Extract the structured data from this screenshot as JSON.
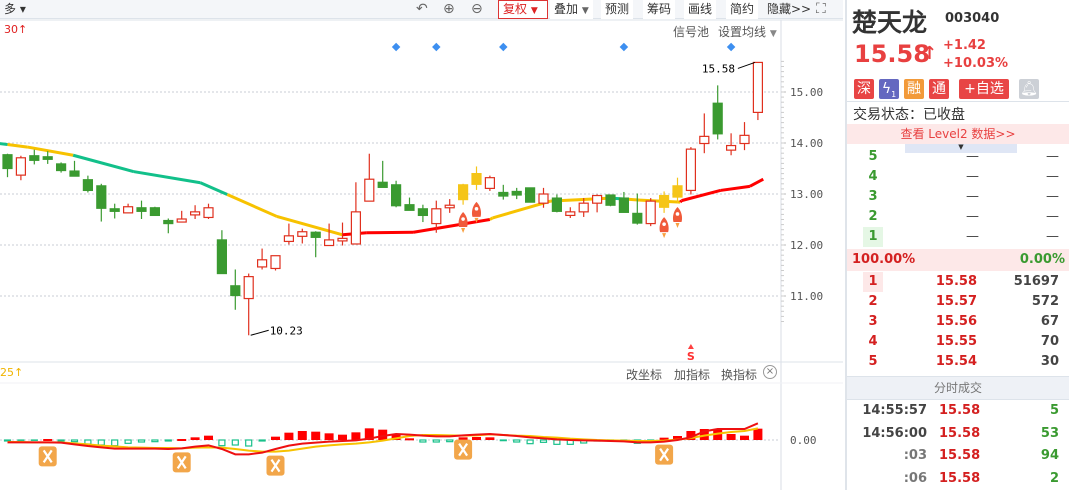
{
  "toolbar": {
    "more_label": "多",
    "rights_label": "复权",
    "overlay_label": "叠加",
    "forecast_label": "预测",
    "chips_label": "筹码",
    "draw_label": "画线",
    "simple_label": "简约",
    "hide_label": "隐藏>>",
    "icons": [
      "undo-icon",
      "zoom-in-icon",
      "zoom-out-icon",
      "fullscreen-icon"
    ]
  },
  "main_chart": {
    "period_label": "30↑",
    "signal_pool_label": "信号池",
    "ma_settings_label": "设置均线",
    "axis_ticks": [
      "15.00",
      "14.00",
      "13.00",
      "12.00",
      "11.00"
    ],
    "low_label": "10.23",
    "high_label": "15.58",
    "sell_marker": "S",
    "colors": {
      "up": "#e0301e",
      "down": "#3a9a30",
      "yellow": "#f5c518",
      "ma_green": "#12c08a",
      "ma_yellow": "#f7c200",
      "ma_red": "#ff0000",
      "diamond": "#3d8ff0"
    }
  },
  "chart_data": {
    "type": "candlestick",
    "ylim": [
      10.0,
      16.0
    ],
    "candles": [
      [
        13.77,
        13.79,
        13.33,
        13.5,
        "down"
      ],
      [
        13.37,
        13.75,
        13.27,
        13.71,
        "up"
      ],
      [
        13.75,
        13.87,
        13.58,
        13.66,
        "down"
      ],
      [
        13.73,
        13.84,
        13.59,
        13.68,
        "down"
      ],
      [
        13.59,
        13.62,
        13.42,
        13.46,
        "down"
      ],
      [
        13.45,
        13.65,
        13.35,
        13.35,
        "down"
      ],
      [
        13.28,
        13.36,
        13.03,
        13.07,
        "down"
      ],
      [
        13.16,
        13.2,
        12.46,
        12.72,
        "down"
      ],
      [
        12.71,
        12.81,
        12.52,
        12.66,
        "down"
      ],
      [
        12.63,
        12.81,
        12.63,
        12.75,
        "up"
      ],
      [
        12.73,
        12.87,
        12.51,
        12.66,
        "down"
      ],
      [
        12.73,
        12.75,
        12.58,
        12.58,
        "down"
      ],
      [
        12.48,
        12.52,
        12.23,
        12.42,
        "down"
      ],
      [
        12.45,
        12.67,
        12.45,
        12.51,
        "up"
      ],
      [
        12.59,
        12.78,
        12.51,
        12.65,
        "up"
      ],
      [
        12.54,
        12.81,
        12.51,
        12.73,
        "up"
      ],
      [
        12.1,
        12.29,
        11.44,
        11.44,
        "down"
      ],
      [
        11.2,
        11.52,
        10.73,
        11.01,
        "down"
      ],
      [
        10.95,
        11.44,
        10.23,
        11.38,
        "up"
      ],
      [
        11.57,
        11.93,
        11.52,
        11.71,
        "up"
      ],
      [
        11.54,
        11.79,
        11.5,
        11.79,
        "up"
      ],
      [
        12.07,
        12.42,
        12.01,
        12.18,
        "up"
      ],
      [
        12.17,
        12.32,
        12.03,
        12.26,
        "up"
      ],
      [
        12.25,
        12.27,
        11.76,
        12.15,
        "down"
      ],
      [
        11.99,
        12.42,
        11.99,
        12.1,
        "up"
      ],
      [
        12.08,
        12.44,
        11.99,
        12.13,
        "up"
      ],
      [
        12.02,
        13.23,
        12.02,
        12.65,
        "up"
      ],
      [
        12.86,
        13.79,
        12.86,
        13.29,
        "up"
      ],
      [
        13.23,
        13.65,
        13.13,
        13.13,
        "down"
      ],
      [
        13.18,
        13.26,
        12.74,
        12.77,
        "down"
      ],
      [
        12.79,
        12.93,
        12.68,
        12.68,
        "down"
      ],
      [
        12.71,
        12.79,
        12.45,
        12.58,
        "down"
      ],
      [
        12.42,
        12.87,
        12.24,
        12.71,
        "up"
      ],
      [
        12.73,
        12.9,
        12.63,
        12.78,
        "up"
      ],
      [
        12.89,
        13.2,
        12.79,
        13.18,
        "yellow"
      ],
      [
        13.19,
        13.54,
        13.08,
        13.4,
        "yellow"
      ],
      [
        13.11,
        13.36,
        13.06,
        13.32,
        "up"
      ],
      [
        13.03,
        13.18,
        12.89,
        12.96,
        "down"
      ],
      [
        13.05,
        13.12,
        12.9,
        12.98,
        "down"
      ],
      [
        13.12,
        13.12,
        12.84,
        12.84,
        "down"
      ],
      [
        12.82,
        13.12,
        12.73,
        13.0,
        "up"
      ],
      [
        12.92,
        12.99,
        12.64,
        12.66,
        "down"
      ],
      [
        12.58,
        12.74,
        12.53,
        12.65,
        "up"
      ],
      [
        12.65,
        12.92,
        12.55,
        12.82,
        "up"
      ],
      [
        12.82,
        12.99,
        12.64,
        12.97,
        "up"
      ],
      [
        12.98,
        12.98,
        12.76,
        12.78,
        "down"
      ],
      [
        12.92,
        13.04,
        12.64,
        12.64,
        "down"
      ],
      [
        12.62,
        13.01,
        12.4,
        12.43,
        "down"
      ],
      [
        12.42,
        12.92,
        12.37,
        12.86,
        "up"
      ],
      [
        12.74,
        13.05,
        12.63,
        12.97,
        "yellow"
      ],
      [
        12.94,
        13.32,
        12.82,
        13.16,
        "yellow"
      ],
      [
        13.07,
        13.92,
        12.99,
        13.88,
        "up"
      ],
      [
        13.99,
        14.58,
        13.8,
        14.13,
        "up"
      ],
      [
        14.78,
        15.13,
        14.07,
        14.18,
        "down"
      ],
      [
        13.86,
        14.19,
        13.76,
        13.95,
        "up"
      ],
      [
        13.99,
        14.41,
        13.86,
        14.15,
        "up"
      ],
      [
        14.6,
        15.58,
        14.45,
        15.58,
        "up"
      ]
    ],
    "ma": [
      [
        -0.6,
        13.99,
        "green"
      ],
      [
        0,
        13.97,
        "green"
      ],
      [
        1.5,
        13.92,
        "yellow"
      ],
      [
        4.9,
        13.76,
        "yellow"
      ],
      [
        9.4,
        13.44,
        "green"
      ],
      [
        14.4,
        13.22,
        "green"
      ],
      [
        16.4,
        12.99,
        "green"
      ],
      [
        20.1,
        12.56,
        "yellow"
      ],
      [
        25,
        12.2,
        "yellow"
      ],
      [
        26.8,
        12.24,
        "red"
      ],
      [
        30.3,
        12.25,
        "red"
      ],
      [
        36,
        12.5,
        "red"
      ],
      [
        36.2,
        12.53,
        "yellow"
      ],
      [
        40.5,
        12.86,
        "yellow"
      ],
      [
        45,
        12.92,
        "yellow"
      ],
      [
        46.2,
        12.9,
        "green"
      ],
      [
        47.2,
        12.88,
        "yellow"
      ],
      [
        50.2,
        12.84,
        "yellow"
      ],
      [
        50.3,
        12.87,
        "red"
      ],
      [
        53.2,
        13.07,
        "red"
      ],
      [
        55.4,
        13.15,
        "red"
      ],
      [
        56.4,
        13.29,
        "red"
      ]
    ],
    "signal_diamonds": [
      29,
      32,
      37,
      46,
      54
    ],
    "rocket_markers": [
      [
        34,
        12.45
      ],
      [
        35,
        12.65
      ],
      [
        49,
        12.35
      ],
      [
        50,
        12.55
      ]
    ],
    "sell_marker_index": 51,
    "indicator": {
      "ylabel_tick": "0.00",
      "hist": [
        -0.03,
        -0.01,
        -0.01,
        0.03,
        -0.03,
        -0.05,
        -0.12,
        -0.15,
        -0.17,
        -0.1,
        -0.06,
        -0.05,
        -0.03,
        0.03,
        0.08,
        0.13,
        -0.17,
        -0.15,
        -0.18,
        -0.03,
        0.1,
        0.22,
        0.27,
        0.25,
        0.2,
        0.16,
        0.23,
        0.35,
        0.31,
        0.17,
        0.05,
        -0.06,
        -0.06,
        -0.05,
        0.08,
        0.09,
        0.08,
        -0.02,
        -0.06,
        -0.11,
        -0.07,
        -0.13,
        -0.13,
        -0.09,
        -0.03,
        -0.03,
        -0.02,
        -0.1,
        -0.03,
        0.07,
        0.12,
        0.27,
        0.33,
        0.3,
        0.18,
        0.13,
        0.34
      ],
      "dif": [
        -0.07,
        -0.07,
        -0.07,
        -0.07,
        -0.08,
        -0.13,
        -0.18,
        -0.22,
        -0.26,
        -0.26,
        -0.26,
        -0.26,
        -0.27,
        -0.25,
        -0.2,
        -0.16,
        -0.27,
        -0.43,
        -0.43,
        -0.38,
        -0.27,
        -0.17,
        -0.11,
        -0.08,
        -0.05,
        -0.03,
        -0.01,
        0.04,
        0.12,
        0.18,
        0.16,
        0.13,
        0.11,
        0.11,
        0.14,
        0.16,
        0.18,
        0.15,
        0.12,
        0.08,
        0.05,
        0.02,
        0.0,
        -0.01,
        -0.02,
        -0.03,
        -0.04,
        -0.07,
        -0.07,
        -0.05,
        0.0,
        0.08,
        0.26,
        0.33,
        0.33,
        0.33,
        0.5
      ],
      "dea": [
        -0.06,
        -0.06,
        -0.07,
        -0.07,
        -0.07,
        -0.1,
        -0.13,
        -0.17,
        -0.19,
        -0.22,
        -0.23,
        -0.24,
        -0.24,
        -0.25,
        -0.23,
        -0.22,
        -0.23,
        -0.27,
        -0.32,
        -0.35,
        -0.35,
        -0.32,
        -0.26,
        -0.2,
        -0.16,
        -0.13,
        -0.11,
        -0.07,
        -0.02,
        0.05,
        0.12,
        0.15,
        0.15,
        0.14,
        0.13,
        0.14,
        0.17,
        0.15,
        0.13,
        0.12,
        0.09,
        0.07,
        0.04,
        0.02,
        0.0,
        -0.01,
        -0.02,
        -0.03,
        -0.03,
        -0.02,
        0.01,
        0.06,
        0.13,
        0.19,
        0.24,
        0.27,
        0.35
      ],
      "cross_markers": [
        3,
        13,
        20,
        34,
        49
      ],
      "period_label": "25↑",
      "change_coord_label": "改坐标",
      "add_indicator_label": "加指标",
      "switch_indicator_label": "换指标"
    }
  },
  "quote": {
    "name": "楚天龙",
    "code": "003040",
    "price": "15.58",
    "arrow": "↑",
    "change": "+1.42",
    "change_pct": "+10.03%",
    "badges": [
      "深",
      "1",
      "融",
      "通"
    ],
    "watchlist_label": "+自选",
    "status_label": "交易状态：已收盘",
    "level2_label": "查看 Level2 数据>>",
    "asks": [
      {
        "lvl": "5",
        "price": "—",
        "vol": "—"
      },
      {
        "lvl": "4",
        "price": "—",
        "vol": "—"
      },
      {
        "lvl": "3",
        "price": "—",
        "vol": "—"
      },
      {
        "lvl": "2",
        "price": "—",
        "vol": "—"
      },
      {
        "lvl": "1",
        "price": "—",
        "vol": "—"
      }
    ],
    "ratio_buy": "100.00%",
    "ratio_sell": "0.00%",
    "bids": [
      {
        "lvl": "1",
        "price": "15.58",
        "vol": "51697"
      },
      {
        "lvl": "2",
        "price": "15.57",
        "vol": "572"
      },
      {
        "lvl": "3",
        "price": "15.56",
        "vol": "67"
      },
      {
        "lvl": "4",
        "price": "15.55",
        "vol": "70"
      },
      {
        "lvl": "5",
        "price": "15.54",
        "vol": "30"
      }
    ],
    "trades_title": "分时成交",
    "trades": [
      {
        "time": "14:55:57",
        "price": "15.58",
        "vol": "5"
      },
      {
        "time": "14:56:00",
        "price": "15.58",
        "vol": "53"
      },
      {
        "time": ":03",
        "price": "15.58",
        "vol": "94"
      },
      {
        "time": ":06",
        "price": "15.58",
        "vol": "2"
      }
    ]
  }
}
